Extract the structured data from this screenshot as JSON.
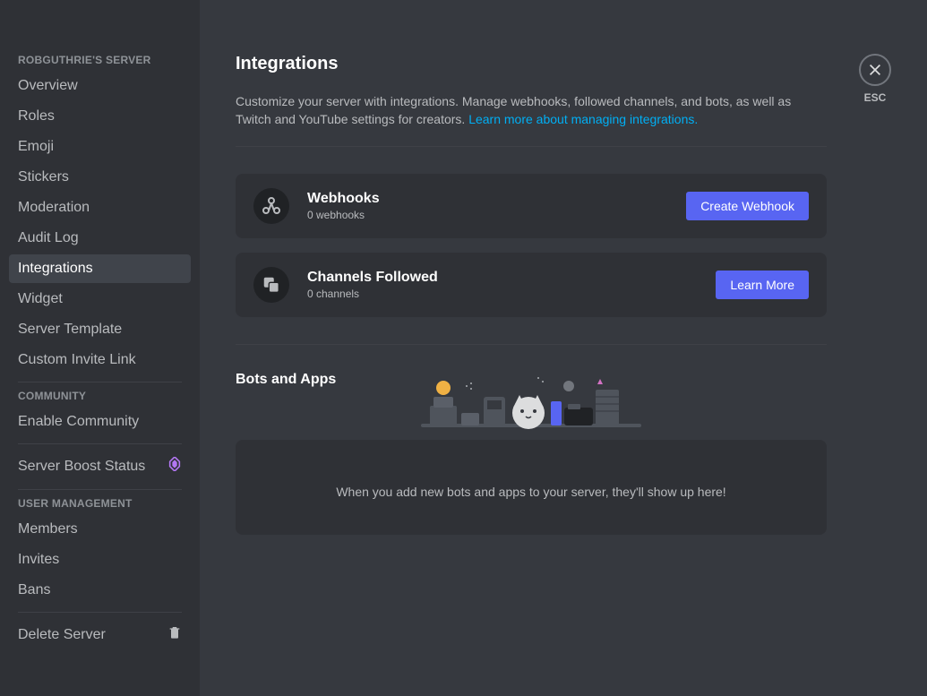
{
  "sidebar": {
    "sections": [
      {
        "header": "ROBGUTHRIE'S SERVER",
        "items": [
          {
            "label": "Overview"
          },
          {
            "label": "Roles"
          },
          {
            "label": "Emoji"
          },
          {
            "label": "Stickers"
          },
          {
            "label": "Moderation"
          },
          {
            "label": "Audit Log"
          },
          {
            "label": "Integrations",
            "active": true
          },
          {
            "label": "Widget"
          },
          {
            "label": "Server Template"
          },
          {
            "label": "Custom Invite Link"
          }
        ]
      },
      {
        "header": "COMMUNITY",
        "items": [
          {
            "label": "Enable Community"
          }
        ]
      },
      {
        "items": [
          {
            "label": "Server Boost Status",
            "boost": true
          }
        ]
      },
      {
        "header": "USER MANAGEMENT",
        "items": [
          {
            "label": "Members"
          },
          {
            "label": "Invites"
          },
          {
            "label": "Bans"
          }
        ]
      },
      {
        "items": [
          {
            "label": "Delete Server",
            "trash": true
          }
        ]
      }
    ]
  },
  "main": {
    "title": "Integrations",
    "description": "Customize your server with integrations. Manage webhooks, followed channels, and bots, as well as Twitch and YouTube settings for creators. ",
    "learn_more_link": "Learn more about managing integrations.",
    "cards": [
      {
        "title": "Webhooks",
        "subtitle": "0 webhooks",
        "button": "Create Webhook",
        "icon": "webhook"
      },
      {
        "title": "Channels Followed",
        "subtitle": "0 channels",
        "button": "Learn More",
        "icon": "channels"
      }
    ],
    "bots_section": {
      "title": "Bots and Apps",
      "empty_text": "When you add new bots and apps to your server, they'll show up here!"
    }
  },
  "close": {
    "label": "ESC"
  }
}
